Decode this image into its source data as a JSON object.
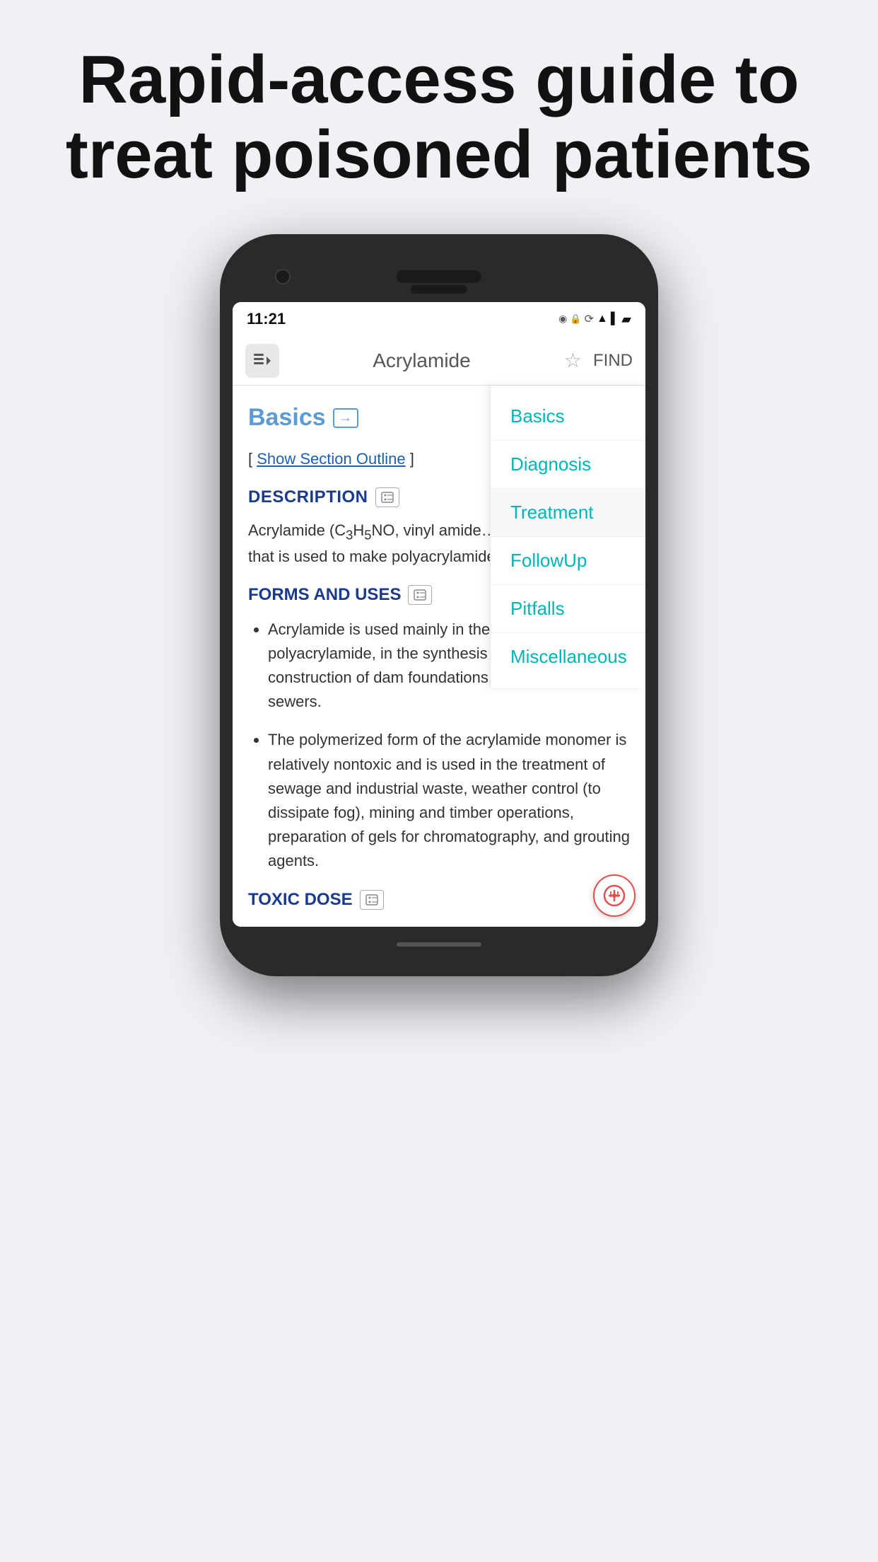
{
  "hero": {
    "title": "Rapid-access guide to treat poisoned patients"
  },
  "phone": {
    "status_bar": {
      "time": "11:21",
      "icons": [
        "location",
        "lock",
        "sync",
        "wifi",
        "signal",
        "battery"
      ]
    },
    "app_header": {
      "logo_icon": "list-icon",
      "title": "Acrylamide",
      "star_icon": "star-icon",
      "find_label": "FIND"
    },
    "nav_menu": {
      "items": [
        {
          "label": "Basics",
          "active": false
        },
        {
          "label": "Diagnosis",
          "active": false
        },
        {
          "label": "Treatment",
          "active": true
        },
        {
          "label": "FollowUp",
          "active": false
        },
        {
          "label": "Pitfalls",
          "active": false
        },
        {
          "label": "Miscellaneous",
          "active": false
        }
      ]
    },
    "content": {
      "section_basics_label": "Basics",
      "show_outline_prefix": "[ ",
      "show_outline_link": "Show Section Outline",
      "show_outline_suffix": " ]",
      "description_heading": "DESCRIPTION",
      "description_text": "Acrylamide (C₃H₅NO, vinyl amide… vinyl monomer that is used to make polyacrylamide.",
      "forms_uses_heading": "FORMS AND USES",
      "bullet_items": [
        "Acrylamide is used mainly in the production of polyacrylamide, in the synthesis of dyes, and in construction of dam foundations, tunnels, and sewers.",
        "The polymerized form of the acrylamide monomer is relatively nontoxic and is used in the treatment of sewage and industrial waste, weather control (to dissipate fog), mining and timber operations, preparation of gels for chromatography, and grouting agents."
      ],
      "toxic_dose_heading": "TOXIC DOSE"
    }
  }
}
